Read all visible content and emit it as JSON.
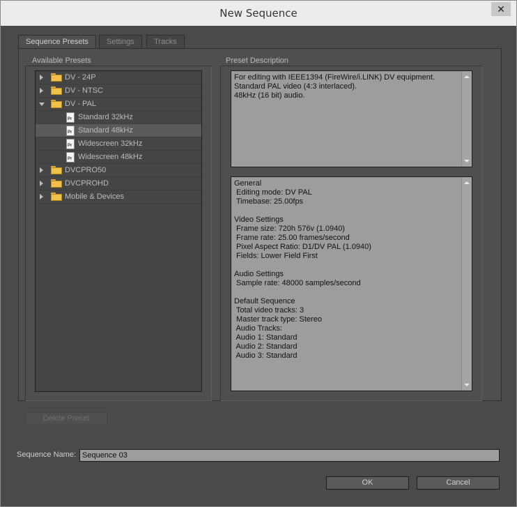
{
  "window": {
    "title": "New Sequence",
    "close_glyph": "✕"
  },
  "tabs": [
    {
      "label": "Sequence Presets",
      "active": true
    },
    {
      "label": "Settings",
      "active": false
    },
    {
      "label": "Tracks",
      "active": false
    }
  ],
  "presets": {
    "group_label": "Available Presets",
    "items": [
      {
        "label": "DV - 24P",
        "type": "folder",
        "expanded": false
      },
      {
        "label": "DV - NTSC",
        "type": "folder",
        "expanded": false
      },
      {
        "label": "DV - PAL",
        "type": "folder",
        "expanded": true
      },
      {
        "label": "Standard 32kHz",
        "type": "preset"
      },
      {
        "label": "Standard 48kHz",
        "type": "preset",
        "selected": true
      },
      {
        "label": "Widescreen 32kHz",
        "type": "preset"
      },
      {
        "label": "Widescreen 48kHz",
        "type": "preset"
      },
      {
        "label": "DVCPRO50",
        "type": "folder",
        "expanded": false
      },
      {
        "label": "DVCPROHD",
        "type": "folder",
        "expanded": false
      },
      {
        "label": "Mobile & Devices",
        "type": "folder",
        "expanded": false
      }
    ],
    "file_icon_text": "Pr"
  },
  "description": {
    "group_label": "Preset Description",
    "summary": [
      "For editing with IEEE1394 (FireWire/i.LINK) DV equipment.",
      "Standard PAL video (4:3 interlaced).",
      "48kHz (16 bit) audio."
    ],
    "details": [
      "General",
      " Editing mode: DV PAL",
      " Timebase: 25.00fps",
      "",
      "Video Settings",
      " Frame size: 720h 576v (1.0940)",
      " Frame rate: 25.00 frames/second",
      " Pixel Aspect Ratio: D1/DV PAL (1.0940)",
      " Fields: Lower Field First",
      "",
      "Audio Settings",
      " Sample rate: 48000 samples/second",
      "",
      "Default Sequence",
      " Total video tracks: 3",
      " Master track type: Stereo",
      " Audio Tracks:",
      " Audio 1: Standard",
      " Audio 2: Standard",
      " Audio 3: Standard"
    ]
  },
  "buttons": {
    "delete_preset": "Delete Preset",
    "ok": "OK",
    "cancel": "Cancel"
  },
  "sequence_name": {
    "label": "Sequence Name:",
    "value": "Sequence 03"
  }
}
